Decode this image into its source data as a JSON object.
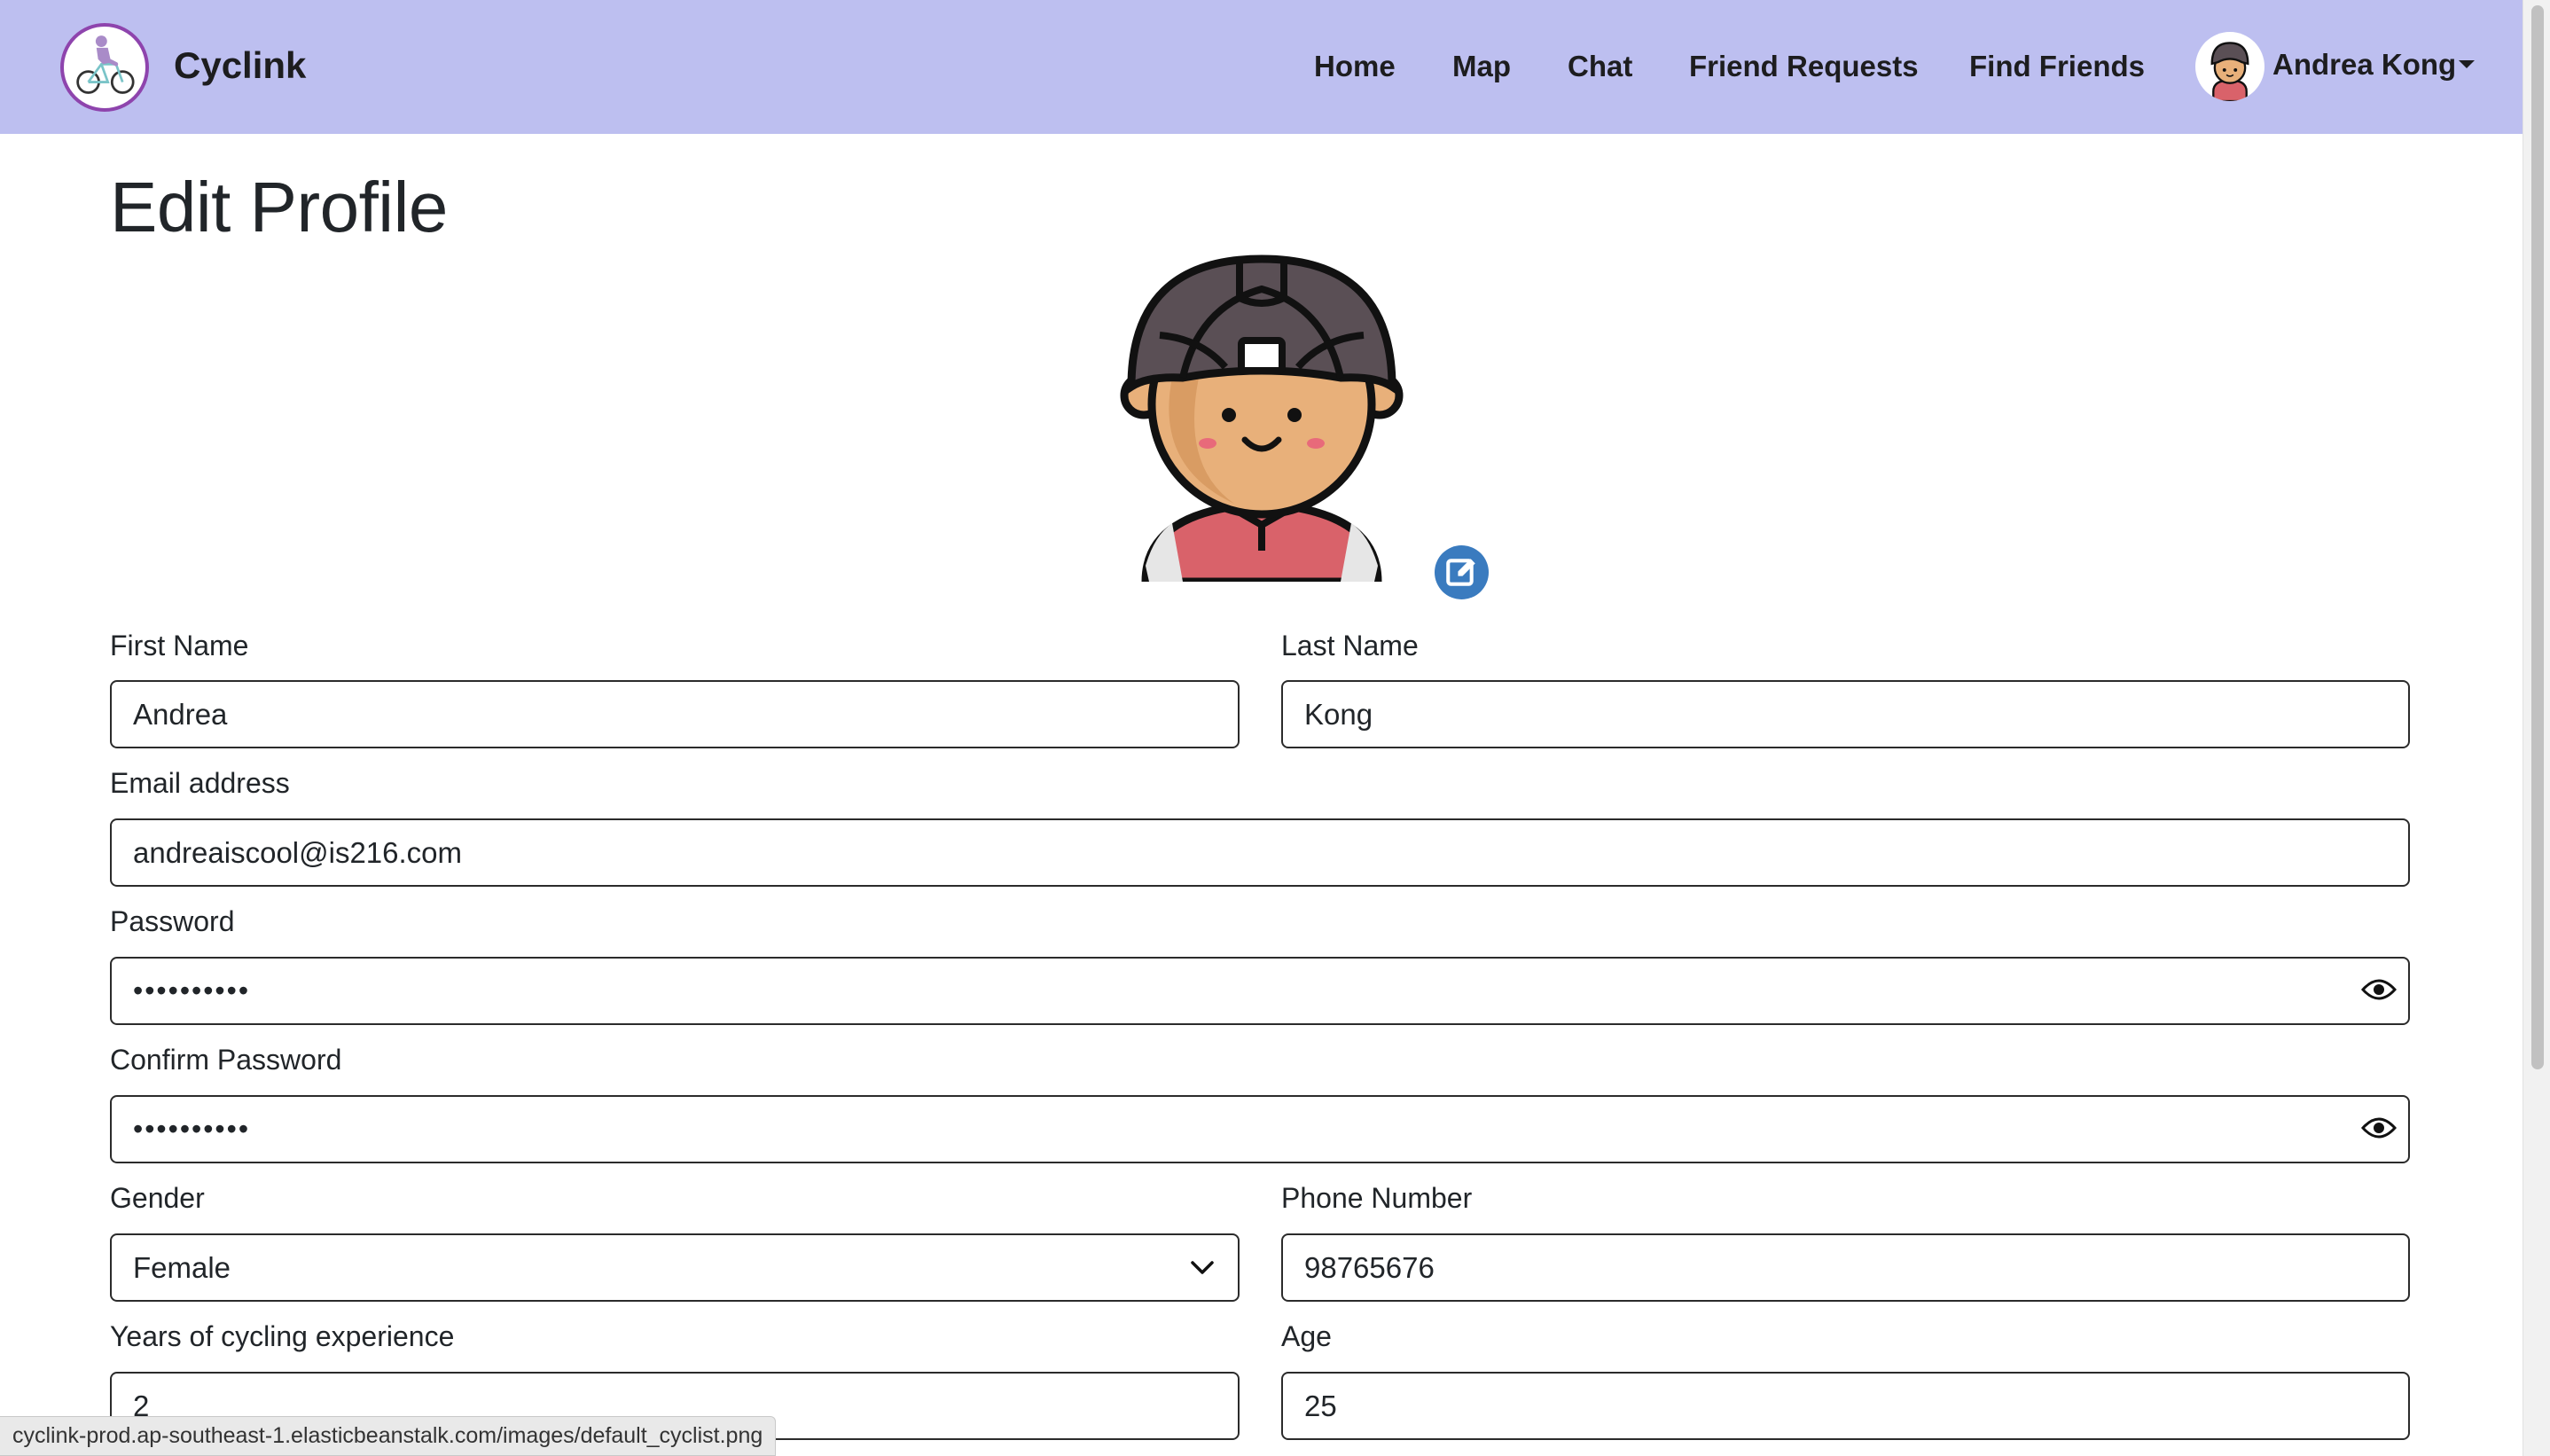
{
  "app": {
    "brand_name": "Cyclink",
    "logo_icon": "bicycle-rider-logo-icon"
  },
  "nav": {
    "links": [
      {
        "label": "Home"
      },
      {
        "label": "Map"
      },
      {
        "label": "Chat"
      },
      {
        "label": "Friend Requests"
      },
      {
        "label": "Find Friends"
      }
    ],
    "user_name": "Andrea Kong",
    "avatar_icon": "cyclist-avatar-icon",
    "dropdown_icon": "caret-down-icon"
  },
  "page": {
    "title": "Edit Profile",
    "profile_picture_icon": "cyclist-avatar-icon",
    "edit_picture_icon": "edit-icon"
  },
  "form": {
    "first_name": {
      "label": "First Name",
      "value": "Andrea"
    },
    "last_name": {
      "label": "Last Name",
      "value": "Kong"
    },
    "email": {
      "label": "Email address",
      "value": "andreaiscool@is216.com"
    },
    "password": {
      "label": "Password",
      "value": "••••••••••",
      "toggle_icon": "eye-icon"
    },
    "confirm_password": {
      "label": "Confirm Password",
      "value": "••••••••••",
      "toggle_icon": "eye-icon"
    },
    "gender": {
      "label": "Gender",
      "value": "Female",
      "dropdown_icon": "chevron-down-icon"
    },
    "phone": {
      "label": "Phone Number",
      "value": "98765676"
    },
    "years_experience": {
      "label": "Years of cycling experience",
      "value": "2"
    },
    "age": {
      "label": "Age",
      "value": "25"
    }
  },
  "status_bar": {
    "url": "cyclink-prod.ap-southeast-1.elasticbeanstalk.com/images/default_cyclist.png"
  },
  "colors": {
    "navbar_bg": "#bdbff0",
    "logo_border": "#8e44ad",
    "edit_button": "#3a7bbf",
    "jersey": "#d9626a",
    "helmet": "#5a4f55",
    "skin": "#e8b07a"
  }
}
